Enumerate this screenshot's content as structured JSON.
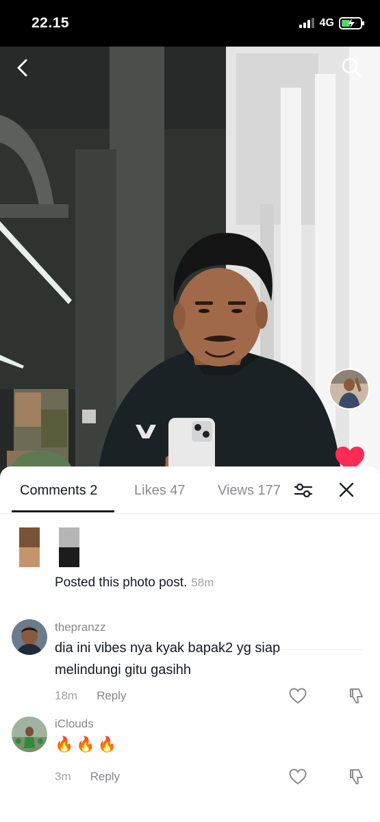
{
  "status_bar": {
    "time": "22.15",
    "network": "4G"
  },
  "photo": {
    "icons": {
      "back": "chevron-left-icon",
      "search": "search-icon",
      "like": "heart-icon"
    },
    "like_color": "#fe2c55"
  },
  "sheet": {
    "tabs": [
      {
        "label": "Comments 2",
        "active": true
      },
      {
        "label": "Likes 47",
        "active": false
      },
      {
        "label": "Views 177",
        "active": false
      }
    ],
    "icons": {
      "filter": "sliders-icon",
      "close": "close-icon"
    },
    "post": {
      "posted_text": "Posted this photo post.",
      "posted_time": "58m"
    },
    "comments": [
      {
        "username": "thepranzz",
        "text": "dia ini vibes nya kyak bapak2 yg siap melindungi gitu gasihh",
        "time": "18m",
        "reply_label": "Reply"
      },
      {
        "username": "iClouds",
        "text": "🔥🔥🔥",
        "time": "3m",
        "reply_label": "Reply"
      }
    ]
  }
}
